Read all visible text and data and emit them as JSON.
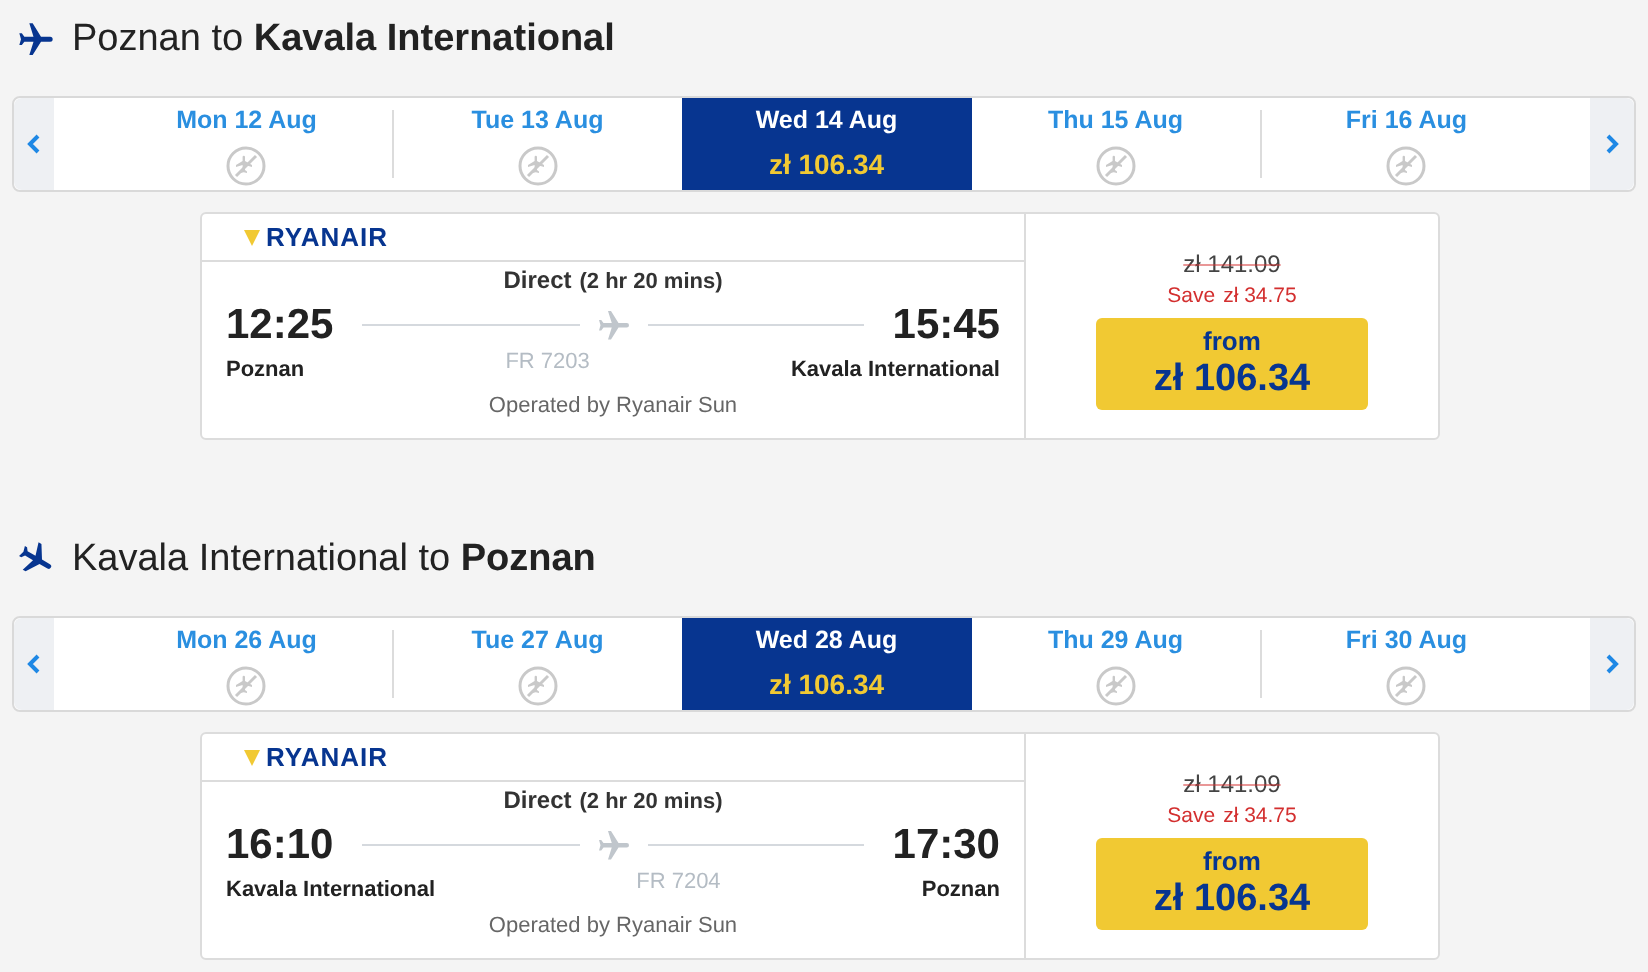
{
  "sections": [
    {
      "kind": "outbound",
      "title": "Poznan to **Kavala International**",
      "dates": [
        {
          "label": "Mon 12 Aug",
          "selected": false
        },
        {
          "label": "Tue 13 Aug",
          "selected": false
        },
        {
          "label": "Wed 14 Aug",
          "price": "zł 106.34",
          "selected": true
        },
        {
          "label": "Thu 15 Aug",
          "selected": false
        },
        {
          "label": "Fri 16 Aug",
          "selected": false
        }
      ],
      "flight": {
        "airline": "RYANAIR",
        "stops": "Direct",
        "duration": "(2 hr 20 mins)",
        "depart_time": "12:25",
        "depart_airport": "Poznan",
        "flight_number": "FR 7203",
        "arrive_time": "15:45",
        "arrive_airport": "Kavala International",
        "operator": "Operated by Ryanair Sun",
        "old_price": "zł 141.09",
        "save_label": "Save",
        "save_amount": "zł 34.75",
        "price_prefix": "from",
        "price": "zł 106.34"
      }
    },
    {
      "kind": "return",
      "title": "Kavala International to **Poznan**",
      "dates": [
        {
          "label": "Mon 26 Aug",
          "selected": false
        },
        {
          "label": "Tue 27 Aug",
          "selected": false
        },
        {
          "label": "Wed 28 Aug",
          "price": "zł 106.34",
          "selected": true
        },
        {
          "label": "Thu 29 Aug",
          "selected": false
        },
        {
          "label": "Fri 30 Aug",
          "selected": false
        }
      ],
      "flight": {
        "airline": "RYANAIR",
        "stops": "Direct",
        "duration": "(2 hr 20 mins)",
        "depart_time": "16:10",
        "depart_airport": "Kavala International",
        "flight_number": "FR 7204",
        "arrive_time": "17:30",
        "arrive_airport": "Poznan",
        "operator": "Operated by Ryanair Sun",
        "old_price": "zł 141.09",
        "save_label": "Save",
        "save_amount": "zł 34.75",
        "price_prefix": "from",
        "price": "zł 106.34"
      }
    }
  ]
}
